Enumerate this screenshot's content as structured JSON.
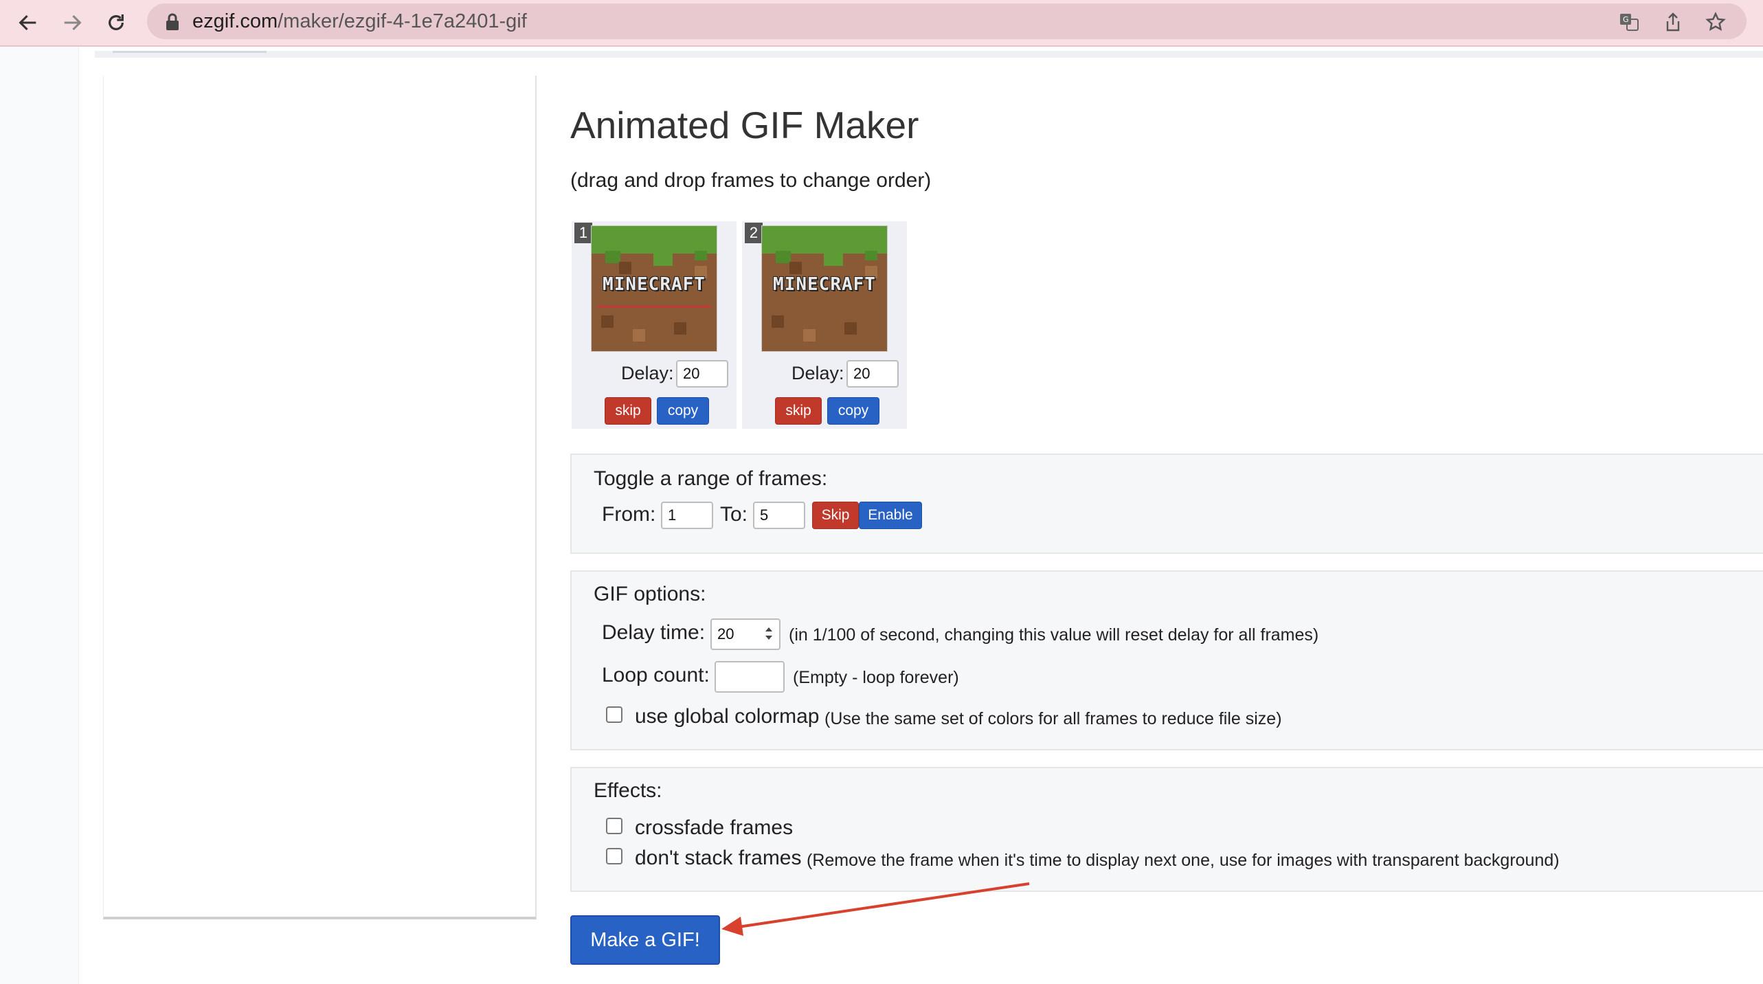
{
  "browser": {
    "url_host": "ezgif.com",
    "url_path": "/maker/ezgif-4-1e7a2401-gif"
  },
  "page": {
    "title": "Animated GIF Maker",
    "subtitle": "(drag and drop frames to change order)"
  },
  "frames": [
    {
      "number": "1",
      "logo_text": "MINECRAFT",
      "delay_label": "Delay:",
      "delay_value": "20",
      "skip_label": "skip",
      "copy_label": "copy"
    },
    {
      "number": "2",
      "logo_text": "MINECRAFT",
      "delay_label": "Delay:",
      "delay_value": "20",
      "skip_label": "skip",
      "copy_label": "copy"
    }
  ],
  "toggle_range": {
    "title": "Toggle a range of frames:",
    "from_label": "From:",
    "from_value": "1",
    "to_label": "To:",
    "to_value": "5",
    "skip_label": "Skip",
    "enable_label": "Enable"
  },
  "gif_options": {
    "title": "GIF options:",
    "delay_label": "Delay time:",
    "delay_value": "20",
    "delay_hint": "(in 1/100 of second, changing this value will reset delay for all frames)",
    "loop_label": "Loop count:",
    "loop_value": "",
    "loop_hint": "(Empty - loop forever)",
    "colormap_label": "use global colormap",
    "colormap_hint": "(Use the same set of colors for all frames to reduce file size)",
    "colormap_checked": false
  },
  "effects": {
    "title": "Effects:",
    "crossfade_label": "crossfade frames",
    "crossfade_checked": false,
    "nostack_label": "don't stack frames",
    "nostack_hint": "(Remove the frame when it's time to display next one, use for images with transparent background)",
    "nostack_checked": false
  },
  "actions": {
    "make_gif_label": "Make a GIF!"
  },
  "colors": {
    "toolbar_bg": "#f7dfe4",
    "skip_red": "#c0392b",
    "copy_blue": "#2862c4",
    "annotation_arrow": "#d9412f"
  },
  "icons": [
    "back-arrow-icon",
    "forward-arrow-icon",
    "reload-icon",
    "lock-icon",
    "translate-icon",
    "share-icon",
    "star-icon"
  ]
}
